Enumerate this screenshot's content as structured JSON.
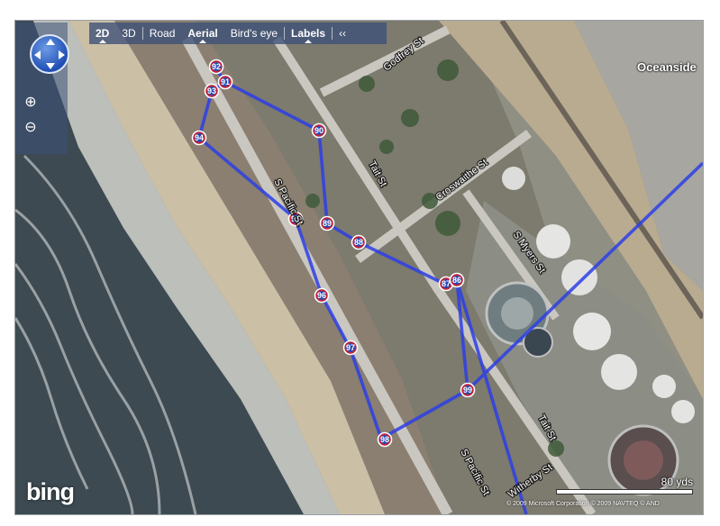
{
  "toolbar": {
    "items": [
      {
        "label": "2D",
        "selected": true
      },
      {
        "label": "3D",
        "selected": false
      },
      {
        "label": "Road",
        "selected": false
      },
      {
        "label": "Aerial",
        "selected": true
      },
      {
        "label": "Bird's eye",
        "selected": false
      },
      {
        "label": "Labels",
        "selected": true
      },
      {
        "label": "‹‹",
        "selected": false
      }
    ]
  },
  "navigation": {
    "compass_icon": "pan-compass-icon",
    "zoom_in_icon": "zoom-in-icon",
    "zoom_out_icon": "zoom-out-icon"
  },
  "place_label": "Oceanside",
  "streets": [
    "Godfrey St",
    "Tait St",
    "S Pacific St",
    "Croswaithe St",
    "S Myers St",
    "Tait St",
    "S Pacific St",
    "Witherby St"
  ],
  "markers": [
    "92",
    "91",
    "93",
    "90",
    "94",
    "95",
    "89",
    "88",
    "87",
    "86",
    "96",
    "97",
    "99",
    "98"
  ],
  "route_color": "#2d3fe6",
  "logo": "bing",
  "scale": {
    "label": "80 yds"
  },
  "copyright": "© 2009 Microsoft Corporation   © 2009 NAVTEQ   © AND"
}
